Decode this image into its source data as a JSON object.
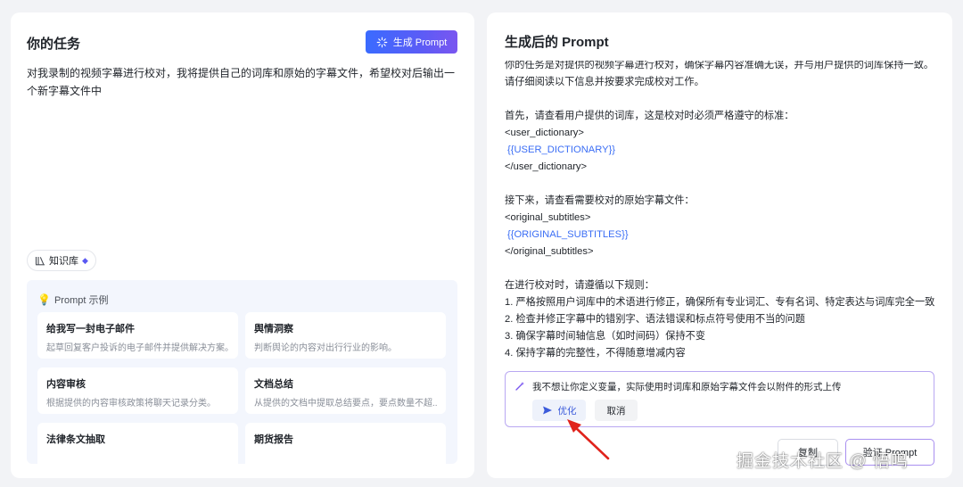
{
  "task_panel": {
    "title": "你的任务",
    "generate_button": "生成 Prompt",
    "task_text": "对我录制的视频字幕进行校对，我将提供自己的词库和原始的字幕文件，希望校对后输出一个新字幕文件中",
    "knowledge_chip": "知识库"
  },
  "examples": {
    "title": "Prompt 示例",
    "items": [
      {
        "title": "给我写一封电子邮件",
        "desc": "起草回复客户投诉的电子邮件并提供解决方案。"
      },
      {
        "title": "舆情洞察",
        "desc": "判断舆论的内容对出行行业的影响。"
      },
      {
        "title": "内容审核",
        "desc": "根据提供的内容审核政策将聊天记录分类。"
      },
      {
        "title": "文档总结",
        "desc": "从提供的文档中提取总结要点，要点数量不超..."
      },
      {
        "title": "法律条文抽取",
        "desc": ""
      },
      {
        "title": "期货报告",
        "desc": ""
      }
    ]
  },
  "result_panel": {
    "title": "生成后的 Prompt",
    "lines": [
      "你的任务是对提供的视频字幕进行校对，确保字幕内容准确无误，并与用户提供的词库保持一致。",
      "请仔细阅读以下信息并按要求完成校对工作。",
      "",
      "首先，请查看用户提供的词库，这是校对时必须严格遵守的标准：",
      "<user_dictionary>",
      "{{USER_DICTIONARY}}",
      "</user_dictionary>",
      "",
      "接下来，请查看需要校对的原始字幕文件：",
      "<original_subtitles>",
      "{{ORIGINAL_SUBTITLES}}",
      "</original_subtitles>",
      "",
      "在进行校对时，请遵循以下规则：",
      "1. 严格按照用户词库中的术语进行修正，确保所有专业词汇、专有名词、特定表达与词库完全一致",
      "2. 检查并修正字幕中的错别字、语法错误和标点符号使用不当的问题",
      "3. 确保字幕时间轴信息（如时间码）保持不变",
      "4. 保持字幕的完整性，不得随意增减内容"
    ],
    "optimize": {
      "message": "我不想让你定义变量，实际使用时词库和原始字幕文件会以附件的形式上传",
      "primary_label": "优化",
      "cancel_label": "取消"
    },
    "copy_label": "复制",
    "verify_label": "验证 Prompt"
  },
  "watermark": "掘金技术社区 @ 悟鸣",
  "colors": {
    "accent": "#3b6ef5",
    "gradient_start": "#3a6bff",
    "gradient_end": "#7a56f0",
    "arrow": "#e0231c"
  }
}
